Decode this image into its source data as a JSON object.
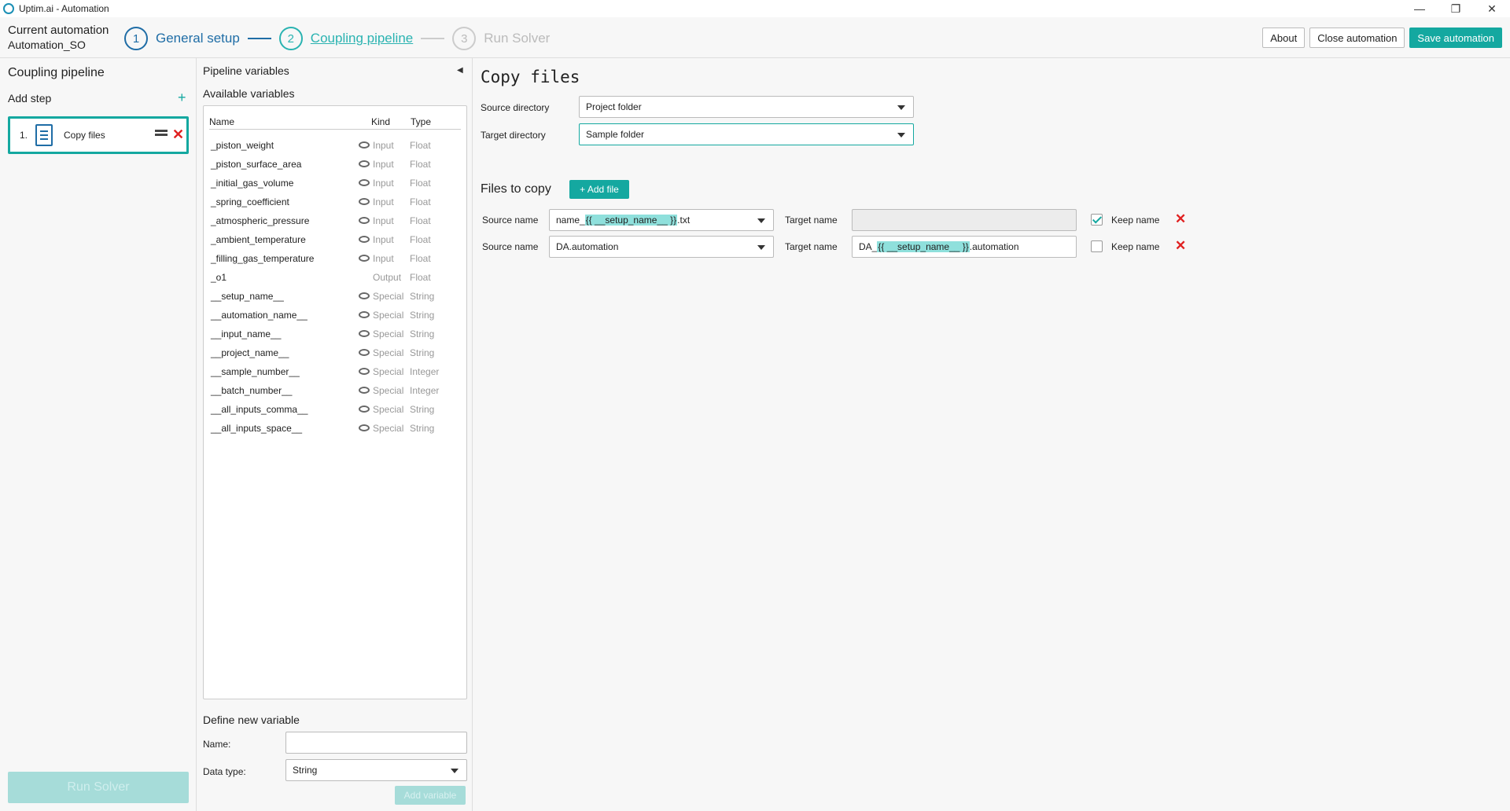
{
  "window": {
    "title": "Uptim.ai - Automation",
    "controls": [
      "minimize",
      "restore",
      "close"
    ]
  },
  "header": {
    "current_label": "Current automation",
    "current_name": "Automation_SO",
    "steps": [
      {
        "num": "1",
        "label": "General setup"
      },
      {
        "num": "2",
        "label": "Coupling pipeline"
      },
      {
        "num": "3",
        "label": "Run Solver"
      }
    ],
    "buttons": {
      "about": "About",
      "close": "Close automation",
      "save": "Save automation"
    }
  },
  "left": {
    "title": "Coupling pipeline",
    "add_step": "Add step",
    "step": {
      "num": "1.",
      "name": "Copy files"
    },
    "run_solver": "Run Solver"
  },
  "pipeline": {
    "title": "Pipeline variables",
    "available": "Available variables",
    "columns": [
      "Name",
      "Kind",
      "Type"
    ],
    "rows": [
      {
        "name": "_piston_weight",
        "eye": true,
        "kind": "Input",
        "type": "Float"
      },
      {
        "name": "_piston_surface_area",
        "eye": true,
        "kind": "Input",
        "type": "Float"
      },
      {
        "name": "_initial_gas_volume",
        "eye": true,
        "kind": "Input",
        "type": "Float"
      },
      {
        "name": "_spring_coefficient",
        "eye": true,
        "kind": "Input",
        "type": "Float"
      },
      {
        "name": "_atmospheric_pressure",
        "eye": true,
        "kind": "Input",
        "type": "Float"
      },
      {
        "name": "_ambient_temperature",
        "eye": true,
        "kind": "Input",
        "type": "Float"
      },
      {
        "name": "_filling_gas_temperature",
        "eye": true,
        "kind": "Input",
        "type": "Float"
      },
      {
        "name": "_o1",
        "eye": false,
        "kind": "Output",
        "type": "Float"
      },
      {
        "name": "__setup_name__",
        "eye": true,
        "kind": "Special",
        "type": "String"
      },
      {
        "name": "__automation_name__",
        "eye": true,
        "kind": "Special",
        "type": "String"
      },
      {
        "name": "__input_name__",
        "eye": true,
        "kind": "Special",
        "type": "String"
      },
      {
        "name": "__project_name__",
        "eye": true,
        "kind": "Special",
        "type": "String"
      },
      {
        "name": "__sample_number__",
        "eye": true,
        "kind": "Special",
        "type": "Integer"
      },
      {
        "name": "__batch_number__",
        "eye": true,
        "kind": "Special",
        "type": "Integer"
      },
      {
        "name": "__all_inputs_comma__",
        "eye": true,
        "kind": "Special",
        "type": "String"
      },
      {
        "name": "__all_inputs_space__",
        "eye": true,
        "kind": "Special",
        "type": "String"
      }
    ],
    "define_new": "Define new variable",
    "name_label": "Name:",
    "name_value": "",
    "type_label": "Data type:",
    "type_value": "String",
    "add_variable": "Add variable"
  },
  "copy": {
    "title": "Copy files",
    "source_dir_label": "Source directory",
    "source_dir_value": "Project folder",
    "target_dir_label": "Target directory",
    "target_dir_value": "Sample folder",
    "files_to_copy": "Files to copy",
    "add_file": "+ Add file",
    "source_name_label": "Source name",
    "target_name_label": "Target name",
    "keep_name_label": "Keep name",
    "files": [
      {
        "source_pre": "name_",
        "source_var": "{{ __setup_name__ }}",
        "source_post": ".txt",
        "target_pre": "",
        "target_var": "",
        "target_post": "",
        "keep": true
      },
      {
        "source_pre": "DA.automation",
        "source_var": "",
        "source_post": "",
        "target_pre": "DA_",
        "target_var": "{{ __setup_name__ }}",
        "target_post": ".automation",
        "keep": false
      }
    ]
  },
  "colors": {
    "accent": "#14a8a0",
    "step_active": "#1f6da6",
    "delete": "#e02020"
  }
}
